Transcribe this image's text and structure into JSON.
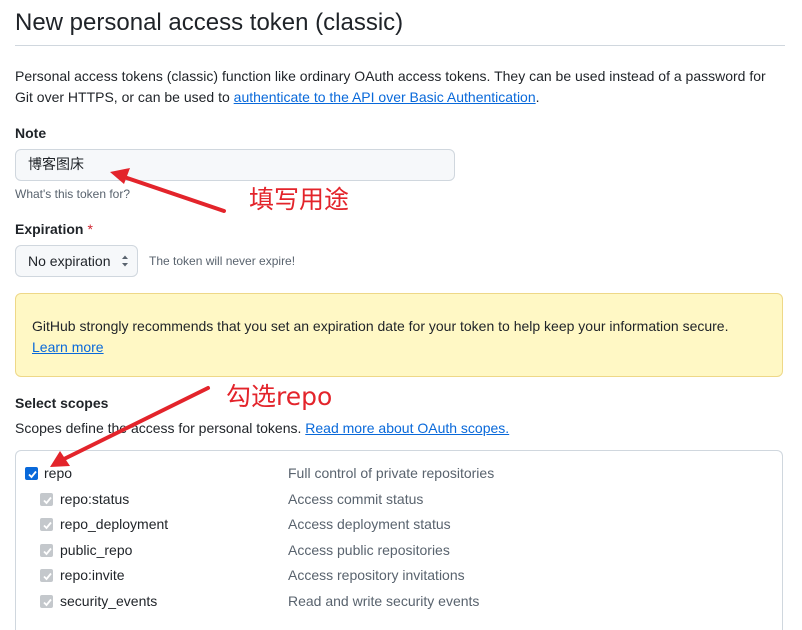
{
  "page": {
    "title": "New personal access token (classic)",
    "intro_text": "Personal access tokens (classic) function like ordinary OAuth access tokens. They can be used instead of a password for Git over HTTPS, or can be used to ",
    "intro_link": "authenticate to the API over Basic Authentication",
    "intro_end": "."
  },
  "note": {
    "label": "Note",
    "value": "博客图床",
    "hint": "What's this token for?"
  },
  "expiration": {
    "label": "Expiration",
    "required_mark": "*",
    "selected": "No expiration",
    "hint": "The token will never expire!"
  },
  "flash": {
    "text": "GitHub strongly recommends that you set an expiration date for your token to help keep your information secure.",
    "link": "Learn more"
  },
  "scopes": {
    "label": "Select scopes",
    "desc_text": "Scopes define the access for personal tokens. ",
    "desc_link": "Read more about OAuth scopes.",
    "items": [
      {
        "name": "repo",
        "desc": "Full control of private repositories",
        "checked": true,
        "disabled": false,
        "bold": true
      },
      {
        "name": "repo:status",
        "desc": "Access commit status",
        "checked": true,
        "disabled": true
      },
      {
        "name": "repo_deployment",
        "desc": "Access deployment status",
        "checked": true,
        "disabled": true
      },
      {
        "name": "public_repo",
        "desc": "Access public repositories",
        "checked": true,
        "disabled": true
      },
      {
        "name": "repo:invite",
        "desc": "Access repository invitations",
        "checked": true,
        "disabled": true
      },
      {
        "name": "security_events",
        "desc": "Read and write security events",
        "checked": true,
        "disabled": true
      }
    ]
  },
  "annotations": {
    "note_callout": "填写用途",
    "repo_callout": "勾选repo",
    "color": "#e3242b"
  }
}
